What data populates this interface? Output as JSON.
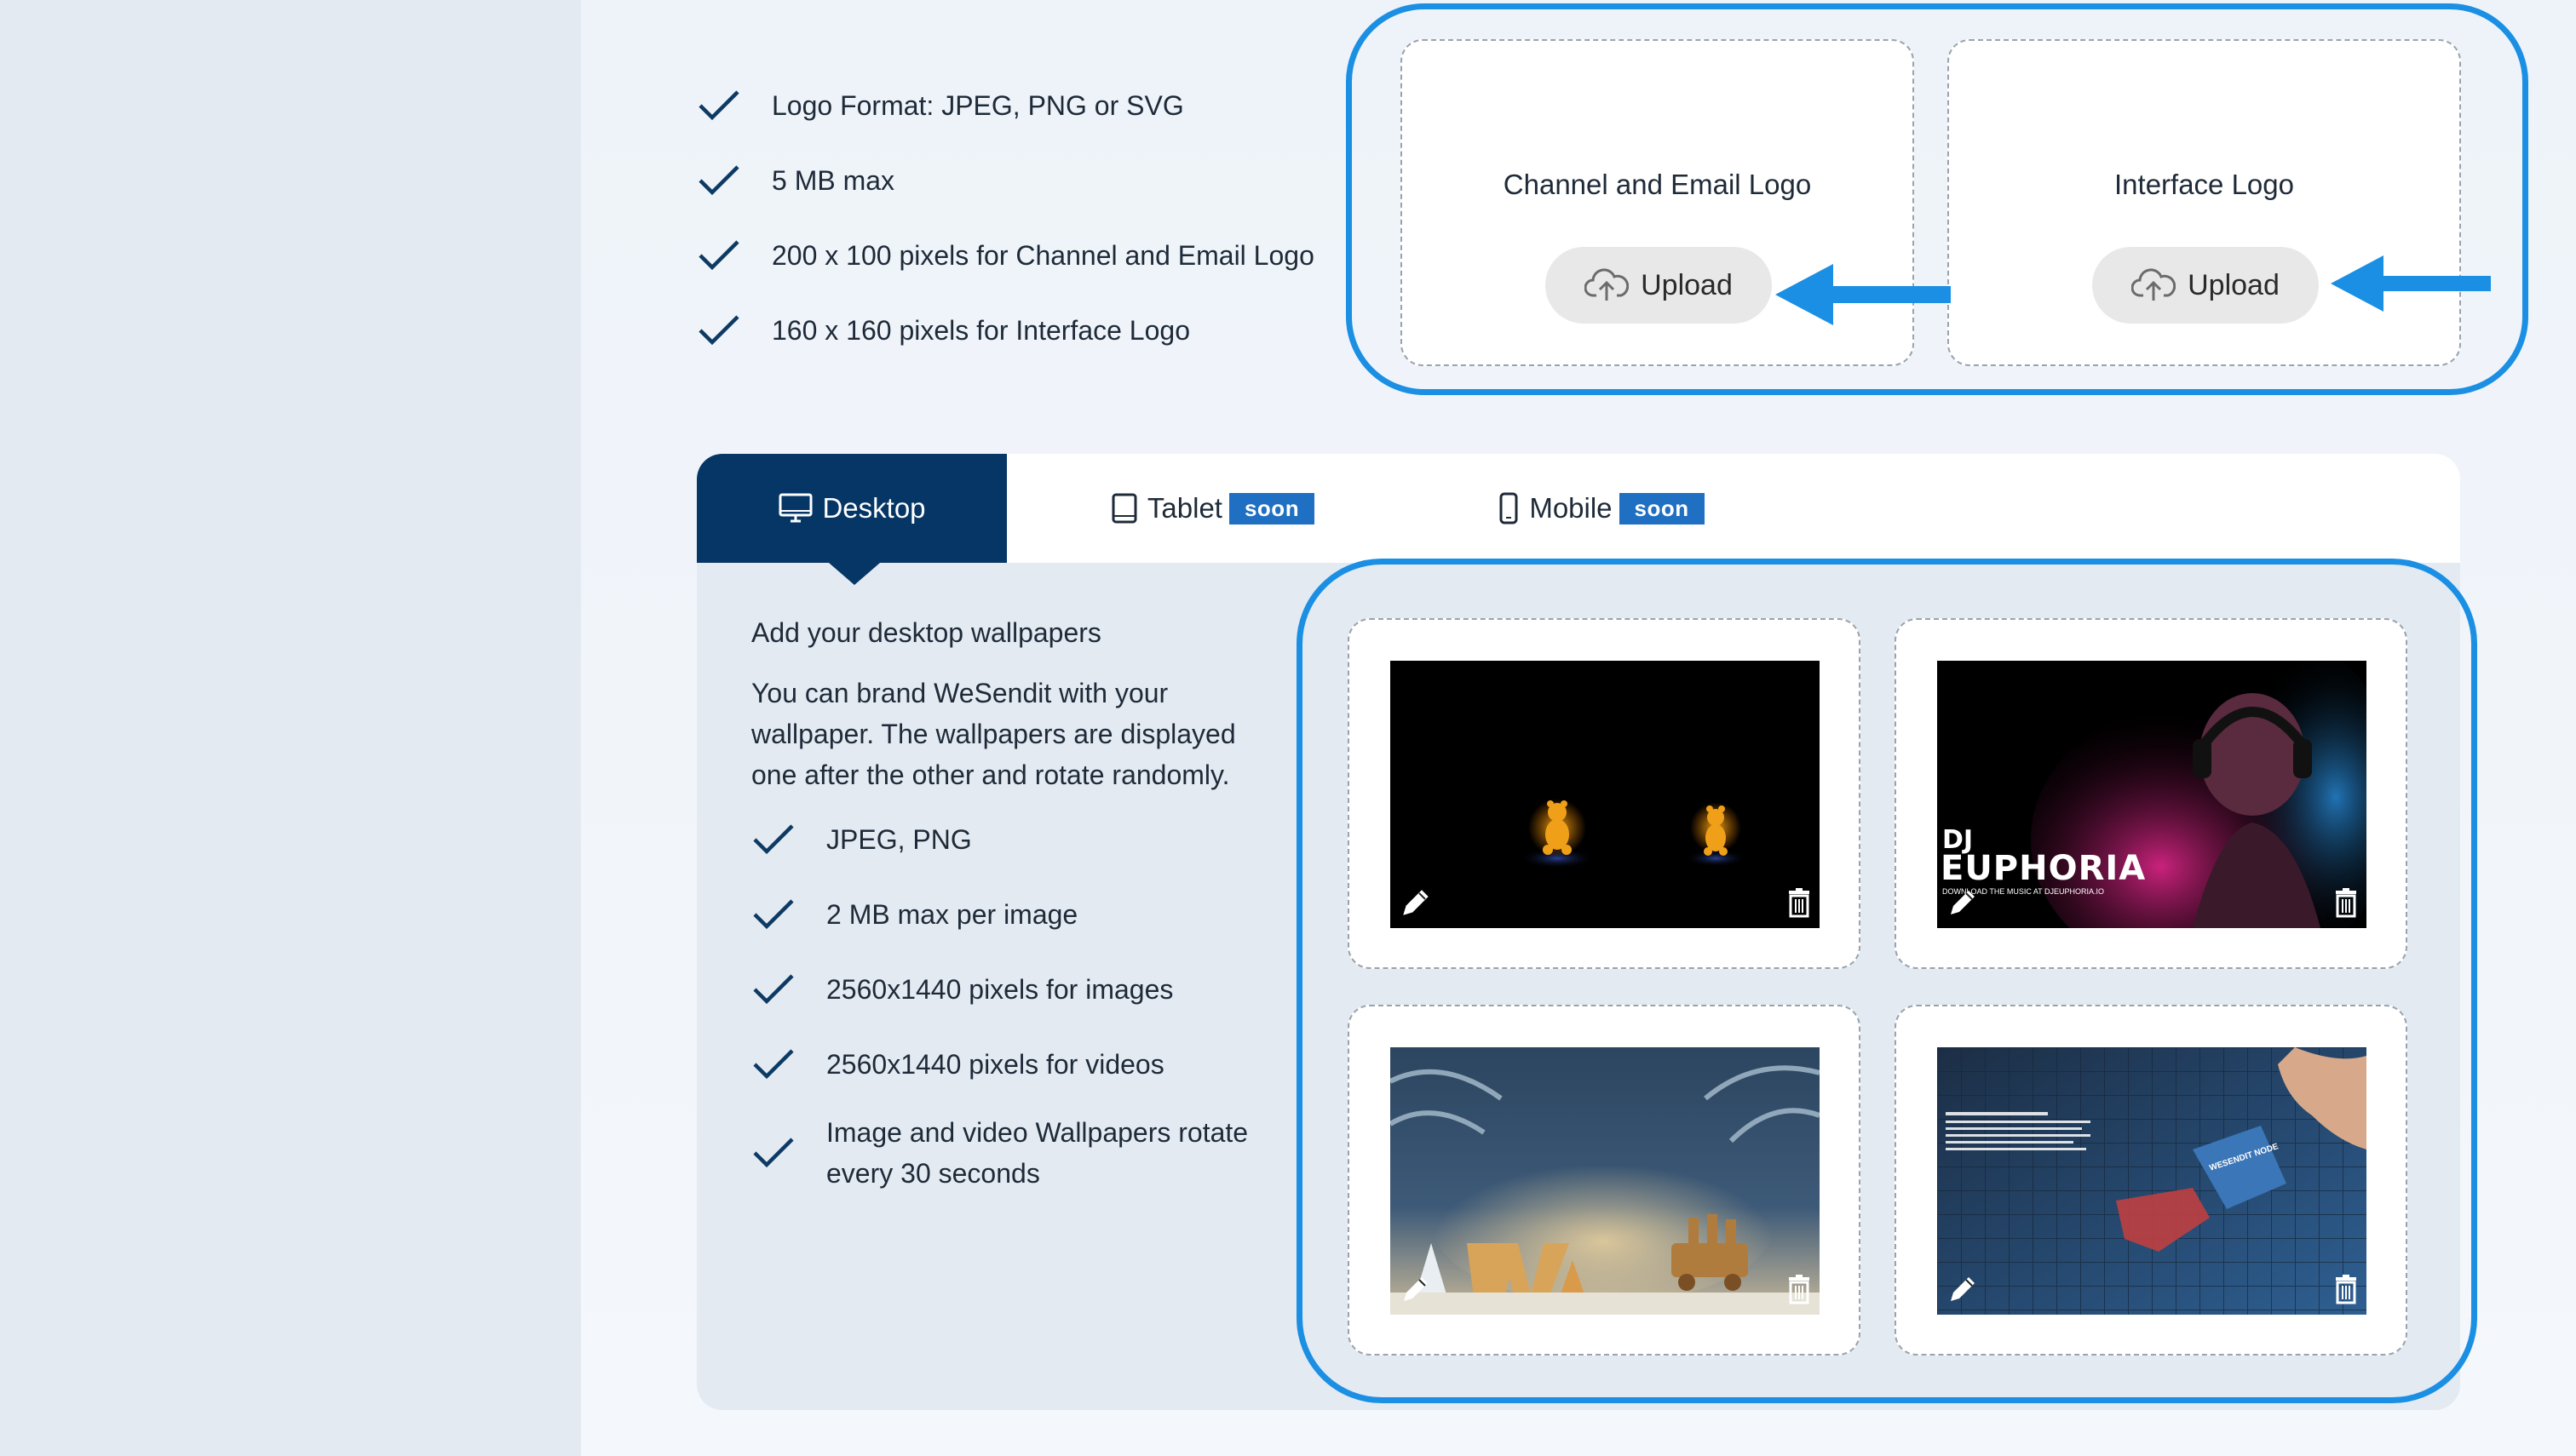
{
  "logo_requirements": [
    "Logo Format: JPEG, PNG or SVG",
    "5 MB max",
    "200 x 100 pixels for Channel and Email Logo",
    "160 x 160 pixels for Interface Logo"
  ],
  "logo_uploads": {
    "channel_email": {
      "title": "Channel and Email Logo",
      "button": "Upload"
    },
    "interface": {
      "title": "Interface Logo",
      "button": "Upload"
    }
  },
  "tabs": [
    {
      "label": "Desktop",
      "badge": ""
    },
    {
      "label": "Tablet",
      "badge": "soon"
    },
    {
      "label": "Mobile",
      "badge": "soon"
    }
  ],
  "desktop_panel": {
    "heading": "Add your desktop wallpapers",
    "description": "You can brand WeSendit with your wallpaper. The wallpapers are displayed one after the other and rotate randomly.",
    "requirements": [
      "JPEG, PNG",
      "2 MB max per image",
      "2560x1440 pixels for images",
      "2560x1440 pixels for videos",
      "Image and video Wallpapers rotate every 30 seconds"
    ]
  },
  "wallpapers": [
    {
      "name": "gummy-bears"
    },
    {
      "name": "dj-euphoria",
      "overlay_title": "DJ",
      "overlay_name": "EUPHORIA",
      "overlay_sub": "DOWNLOAD THE MUSIC AT DJEUPHORIA.IO"
    },
    {
      "name": "winter-w-letter"
    },
    {
      "name": "puzzle-piece",
      "overlay_title": "WESENDIT NODE"
    }
  ],
  "colors": {
    "accent": "#1a8fe3",
    "tab_active": "#053665",
    "badge": "#1f6fc2",
    "check": "#0d3a63"
  }
}
